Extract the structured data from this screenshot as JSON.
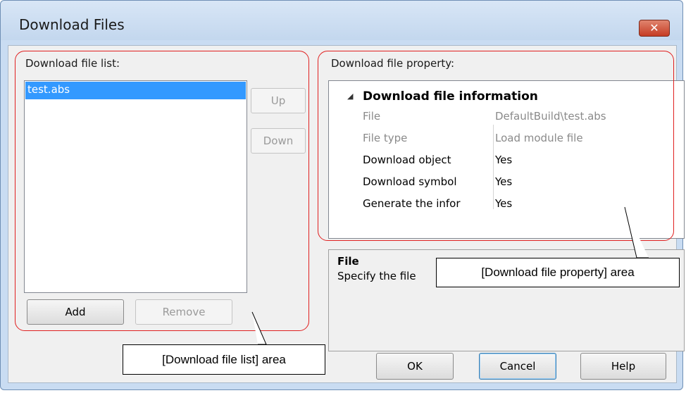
{
  "window": {
    "title": "Download Files"
  },
  "file_list": {
    "label": "Download file list:",
    "items": [
      "test.abs"
    ],
    "up_label": "Up",
    "down_label": "Down",
    "add_label": "Add",
    "remove_label": "Remove"
  },
  "property": {
    "label": "Download file property:",
    "category": "Download file information",
    "rows": [
      {
        "name": "File",
        "value": "DefaultBuild\\test.abs"
      },
      {
        "name": "File type",
        "value": "Load module file"
      },
      {
        "name": "Download object",
        "value": "Yes"
      },
      {
        "name": "Download symbol",
        "value": "Yes"
      },
      {
        "name": "Generate the infor",
        "value": "Yes"
      }
    ]
  },
  "description": {
    "title": "File",
    "text": "Specify the file"
  },
  "buttons": {
    "ok": "OK",
    "cancel": "Cancel",
    "help": "Help"
  },
  "callouts": {
    "property_area": "[Download file property] area",
    "list_area": "[Download file list] area"
  },
  "colors": {
    "highlight": "#3399ff",
    "annotation": "#e02020",
    "close": "#c53c24"
  }
}
